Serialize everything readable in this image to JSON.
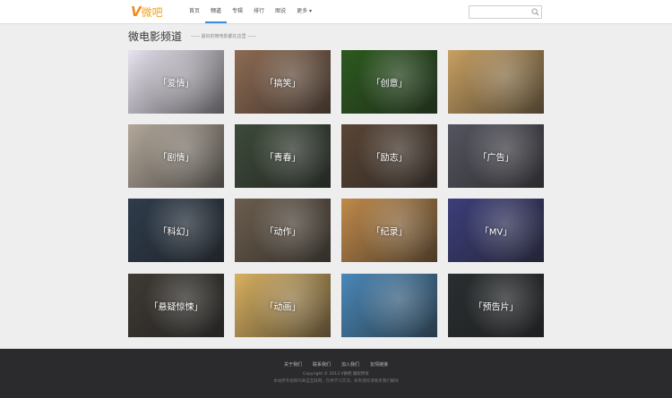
{
  "header": {
    "logo_mark": "V",
    "logo_text": "微吧",
    "nav": [
      "首页",
      "频道",
      "专辑",
      "排行",
      "图说",
      "更多 ▾"
    ],
    "active_nav": 1,
    "search_placeholder": ""
  },
  "page": {
    "title": "微电影频道",
    "subtitle": "—— 最好的微电影都在这里 ——"
  },
  "channels": [
    {
      "label": "「爱情」",
      "color": "#e8e3ef"
    },
    {
      "label": "「搞笑」",
      "color": "#8e6b52"
    },
    {
      "label": "「创意」",
      "color": "#2c5a1e"
    },
    {
      "label": "",
      "color": "#c8a062"
    },
    {
      "label": "「剧情」",
      "color": "#b3a89a"
    },
    {
      "label": "「青春」",
      "color": "#3d4a3a"
    },
    {
      "label": "「励志」",
      "color": "#5a4636"
    },
    {
      "label": "「广告」",
      "color": "#555560"
    },
    {
      "label": "「科幻」",
      "color": "#2e3c4c"
    },
    {
      "label": "「动作」",
      "color": "#6c5e4e"
    },
    {
      "label": "「纪录」",
      "color": "#c08a4a"
    },
    {
      "label": "「MV」",
      "color": "#3c3e7a"
    },
    {
      "label": "「悬疑惊悚」",
      "color": "#3e3a34"
    },
    {
      "label": "「动画」",
      "color": "#d8b060"
    },
    {
      "label": "",
      "color": "#4a88b8"
    },
    {
      "label": "「预告片」",
      "color": "#2a2e30"
    }
  ],
  "footer": {
    "links": [
      "关于我们",
      "联系我们",
      "加入我们",
      "友情链接"
    ],
    "copyright": "Copyright © 2013 V微吧 版权所有",
    "note": "本站所有视频均来自互联网，仅供学习交流，如有侵权请联系我们删除"
  }
}
